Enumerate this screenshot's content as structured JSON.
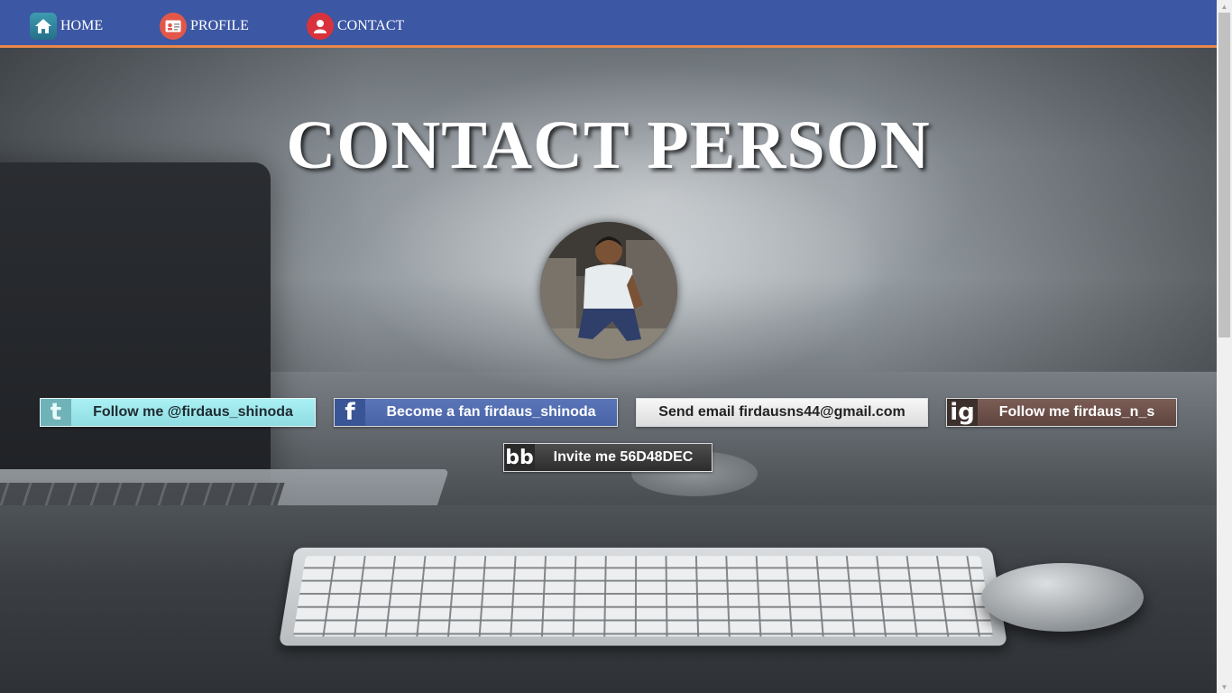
{
  "nav": {
    "items": [
      {
        "label": "HOME",
        "icon": "home-icon"
      },
      {
        "label": "PROFILE",
        "icon": "id-card-icon"
      },
      {
        "label": "CONTACT",
        "icon": "person-icon"
      }
    ],
    "background": "#3c57a3",
    "accent": "#e9874a"
  },
  "main": {
    "title": "CONTACT PERSON",
    "avatar_alt": "profile photo"
  },
  "social": {
    "twitter": {
      "badge": "t",
      "label": "Follow me @firdaus_shinoda",
      "icon": "twitter-icon"
    },
    "facebook": {
      "badge": "f",
      "label": "Become a fan firdaus_shinoda",
      "icon": "facebook-icon"
    },
    "email": {
      "label": "Send email firdausns44@gmail.com"
    },
    "instagram": {
      "badge": "ig",
      "label": "Follow me firdaus_n_s",
      "icon": "instagram-icon"
    },
    "bbm": {
      "badge": "bb",
      "label": "Invite me 56D48DEC",
      "icon": "blackberry-icon"
    }
  },
  "scrollbar": {
    "up_glyph": "▲",
    "down_glyph": "▼"
  }
}
